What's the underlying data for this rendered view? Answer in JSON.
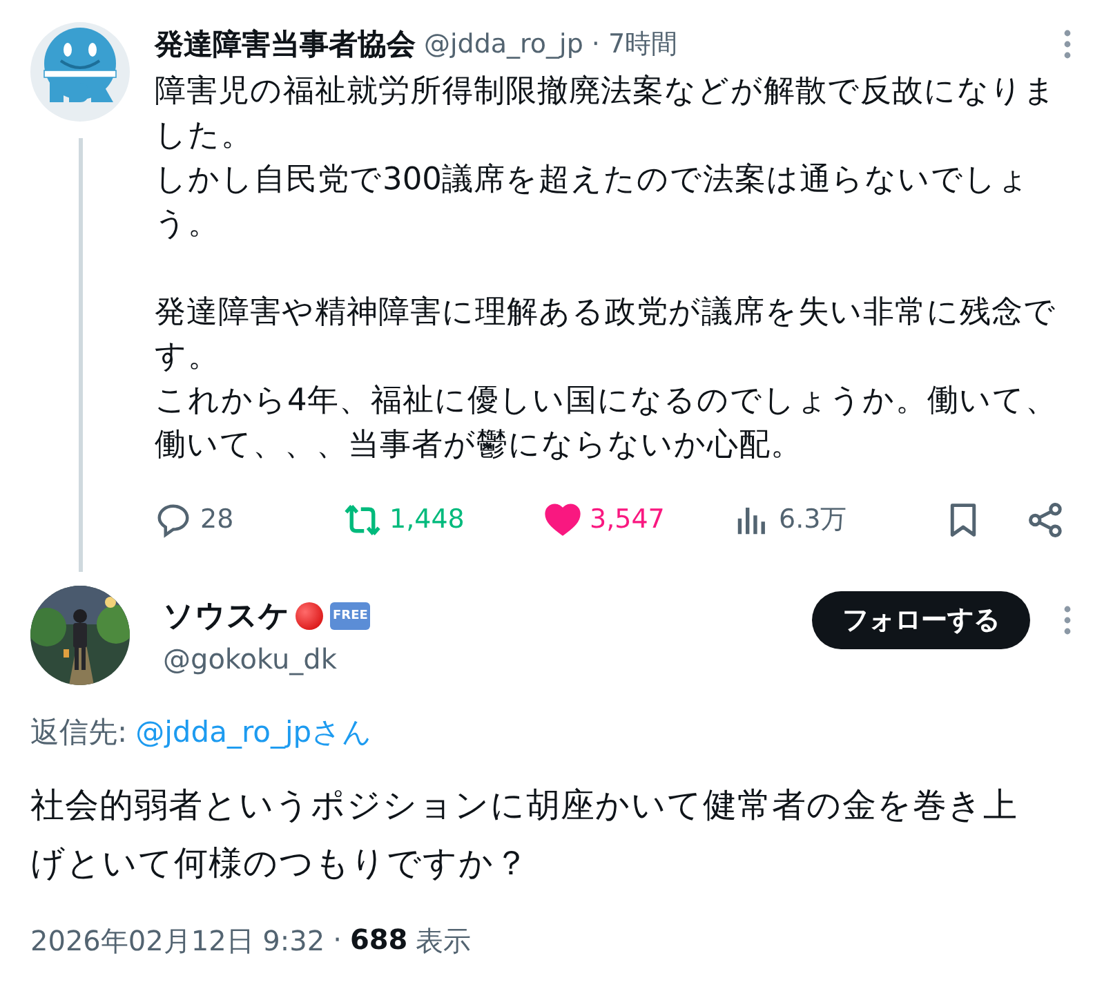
{
  "parent_tweet": {
    "author": "発達障害当事者協会",
    "handle": "@jdda_ro_jp",
    "time": "7時間",
    "separator": "·",
    "paragraphs": [
      [
        "障害児の福祉就労所得制限撤廃法案などが解散で反故になりました。",
        "しかし自民党で300議席を超えたので法案は通らないでしょう。"
      ],
      [
        "発達障害や精神障害に理解ある政党が議席を失い非常に残念です。",
        "これから4年、福祉に優しい国になるのでしょうか。働いて、働いて、、、当事者が鬱にならないか心配。"
      ]
    ],
    "actions": [
      {
        "kind": "reply",
        "count": "28"
      },
      {
        "kind": "repost",
        "count": "1,448"
      },
      {
        "kind": "like",
        "count": "3,547",
        "selected": true
      },
      {
        "kind": "views",
        "count": "6.3万"
      },
      {
        "kind": "bookmark"
      },
      {
        "kind": "share"
      }
    ]
  },
  "reply_tweet": {
    "author": "ソウスケ",
    "badge": "FREE",
    "handle": "@gokoku_dk",
    "follow_button": "フォローする",
    "reply_to_label": "返信先:",
    "reply_to": "@jdda_ro_jpさん",
    "text": "社会的弱者というポジションに胡座かいて健常者の金を巻き上げといて何様のつもりですか？",
    "date": "2026年02月12日 9:32",
    "separator": "·",
    "views_count": "688",
    "views_label": "表示"
  }
}
